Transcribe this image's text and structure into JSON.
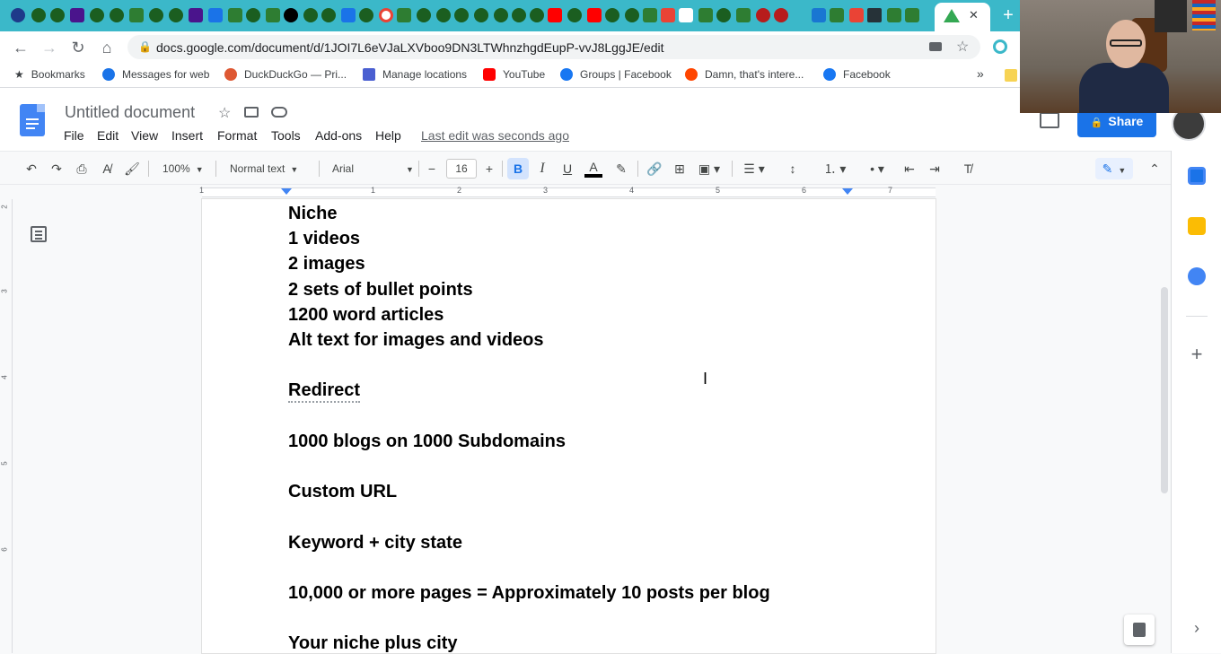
{
  "browser": {
    "url": "docs.google.com/document/d/1JOI7L6eVJaLXVboo9DN3LTWhnzhgdEupP-vvJ8LggJE/edit",
    "tab_close": "✕",
    "new_tab": "+",
    "bookmarks": [
      {
        "label": "Bookmarks",
        "color": "#3c4043"
      },
      {
        "label": "Messages for web",
        "color": "#1a73e8"
      },
      {
        "label": "DuckDuckGo — Pri...",
        "color": "#de5833"
      },
      {
        "label": "Manage locations",
        "color": "#4a5fd1"
      },
      {
        "label": "YouTube",
        "color": "#ff0000"
      },
      {
        "label": "Groups | Facebook",
        "color": "#1877f2"
      },
      {
        "label": "Damn, that's intere...",
        "color": "#ff4500"
      },
      {
        "label": "Facebook",
        "color": "#1877f2"
      }
    ],
    "bookmarks_overflow": "»"
  },
  "docs": {
    "title": "Untitled document",
    "menu": [
      "File",
      "Edit",
      "View",
      "Insert",
      "Format",
      "Tools",
      "Add-ons",
      "Help"
    ],
    "last_edit": "Last edit was seconds ago",
    "share_label": "Share"
  },
  "toolbar": {
    "zoom": "100%",
    "style": "Normal text",
    "font": "Arial",
    "font_size": "16",
    "minus": "−",
    "plus": "+",
    "bold": "B",
    "italic": "I",
    "underline": "U",
    "text_color": "A"
  },
  "ruler": {
    "numbers": [
      "1",
      "1",
      "2",
      "3",
      "4",
      "5",
      "6",
      "7"
    ],
    "vertical": [
      "2",
      "3",
      "4",
      "5",
      "6"
    ]
  },
  "document": {
    "lines": [
      "Niche",
      "1 videos",
      "2 images",
      "2 sets of bullet points",
      "1200 word articles",
      "Alt text for images and videos",
      "Redirect",
      "1000 blogs on 1000 Subdomains",
      "Custom URL",
      "Keyword + city state",
      "10,000 or more pages = Approximately 10 posts per blog",
      "Your niche plus city"
    ]
  },
  "colors": {
    "tab_strip": "#3bb8c9",
    "accent": "#1a73e8",
    "docs_blue": "#4285f4"
  }
}
